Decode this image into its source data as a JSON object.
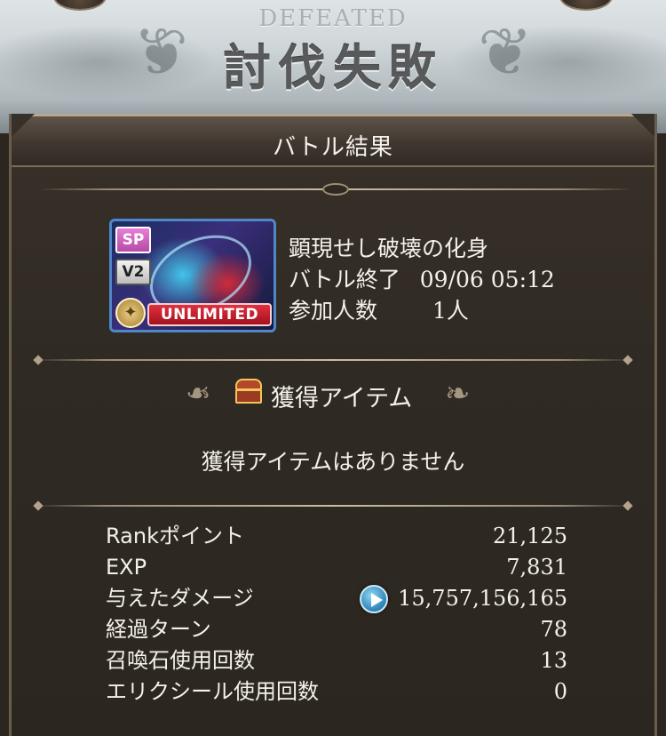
{
  "header": {
    "title_en": "DEFEATED",
    "title_jp": "討伐失敗"
  },
  "panel": {
    "title": "バトル結果"
  },
  "quest": {
    "name": "顕現せし破壊の化身",
    "end_label": "バトル終了",
    "end_value": "09/06 05:12",
    "participants_label": "参加人数",
    "participants_value": "1人",
    "badges": {
      "sp": "SP",
      "v2": "V2",
      "unlimited": "UNLIMITED"
    }
  },
  "items": {
    "title": "獲得アイテム",
    "empty_message": "獲得アイテムはありません",
    "icon": "treasure-chest-icon"
  },
  "stats": [
    {
      "label": "Rankポイント",
      "value": "21,125"
    },
    {
      "label": "EXP",
      "value": "7,831"
    },
    {
      "label": "与えたダメージ",
      "value": "15,757,156,165"
    },
    {
      "label": "経過ターン",
      "value": "78"
    },
    {
      "label": "召喚石使用回数",
      "value": "13"
    },
    {
      "label": "エリクシール使用回数",
      "value": "0"
    }
  ],
  "colors": {
    "panel_bg": "#2b2620",
    "frame_gold": "#b9a68c",
    "unlimited_red": "#d02b3a",
    "play_blue": "#2b83b8"
  }
}
